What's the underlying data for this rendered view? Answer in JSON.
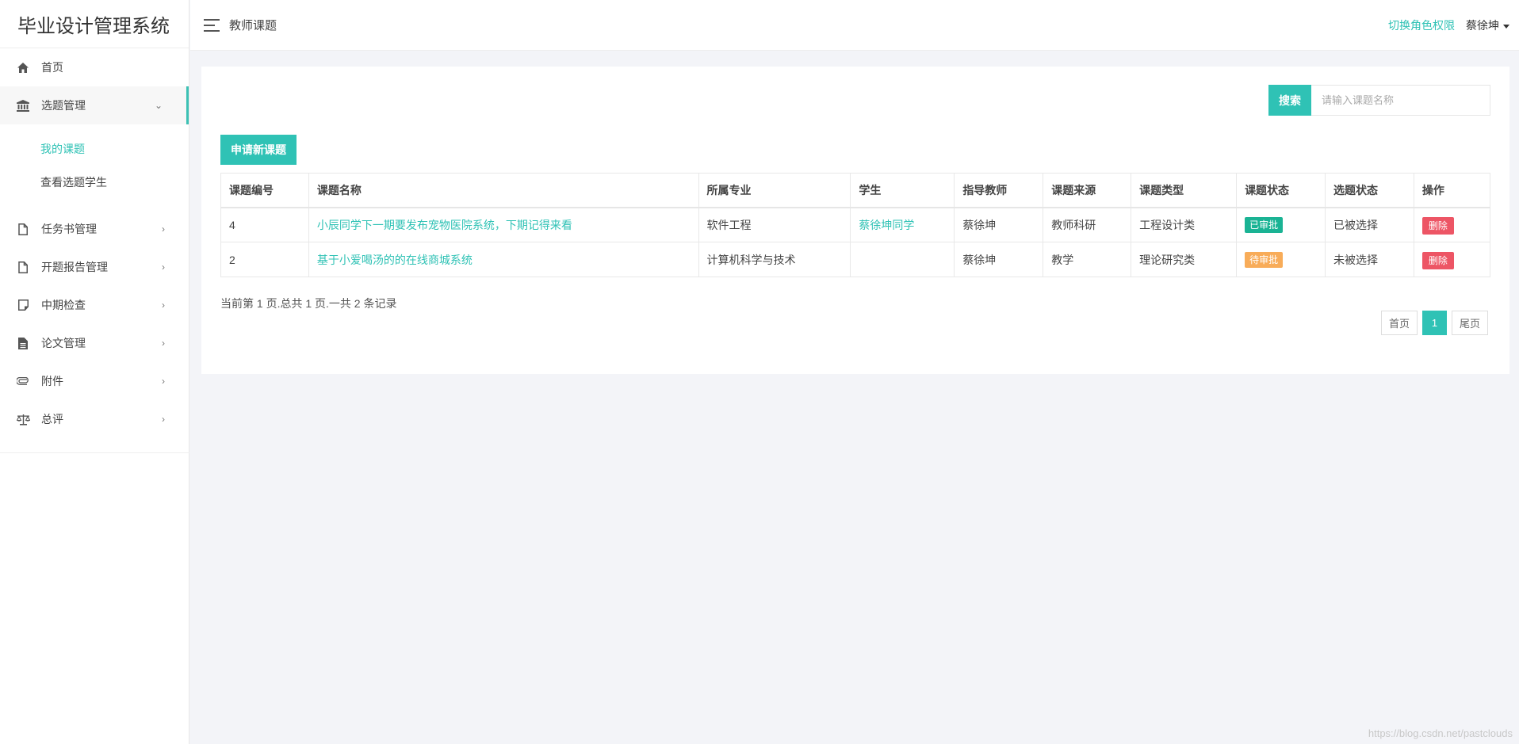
{
  "app": {
    "title": "毕业设计管理系统"
  },
  "header": {
    "page_title": "教师课题",
    "switch_role": "切换角色权限",
    "user_name": "蔡徐坤"
  },
  "sidebar": {
    "items": [
      {
        "label": "首页",
        "icon": "home-icon"
      },
      {
        "label": "选题管理",
        "icon": "bank-icon"
      },
      {
        "label": "任务书管理",
        "icon": "file-icon"
      },
      {
        "label": "开题报告管理",
        "icon": "file-icon"
      },
      {
        "label": "中期检查",
        "icon": "note-icon"
      },
      {
        "label": "论文管理",
        "icon": "file-text-icon"
      },
      {
        "label": "附件",
        "icon": "paperclip-icon"
      },
      {
        "label": "总评",
        "icon": "balance-scale-icon"
      }
    ],
    "sub_items": [
      {
        "label": "我的课题"
      },
      {
        "label": "查看选题学生"
      }
    ]
  },
  "search": {
    "button": "搜索",
    "placeholder": "请输入课题名称"
  },
  "actions": {
    "apply": "申请新课题"
  },
  "table": {
    "headers": [
      "课题编号",
      "课题名称",
      "所属专业",
      "学生",
      "指导教师",
      "课题来源",
      "课题类型",
      "课题状态",
      "选题状态",
      "操作"
    ],
    "rows": [
      {
        "id": "4",
        "name": "小辰同学下一期要发布宠物医院系统，下期记得来看",
        "major": "软件工程",
        "student": "蔡徐坤同学",
        "teacher": "蔡徐坤",
        "source": "教师科研",
        "type": "工程设计类",
        "status": "已审批",
        "selection": "已被选择",
        "op": "删除"
      },
      {
        "id": "2",
        "name": "基于小爱喝汤的的在线商城系统",
        "major": "计算机科学与技术",
        "student": "",
        "teacher": "蔡徐坤",
        "source": "教学",
        "type": "理论研究类",
        "status": "待审批",
        "selection": "未被选择",
        "op": "删除"
      }
    ]
  },
  "pagination": {
    "info": "当前第 1 页.总共 1 页.一共 2 条记录",
    "first": "首页",
    "current": "1",
    "last": "尾页"
  },
  "watermark": "https://blog.csdn.net/pastclouds",
  "colors": {
    "accent": "#2fc2b5",
    "approved": "#1ab394",
    "pending": "#f8ac59",
    "danger": "#ed5565"
  }
}
